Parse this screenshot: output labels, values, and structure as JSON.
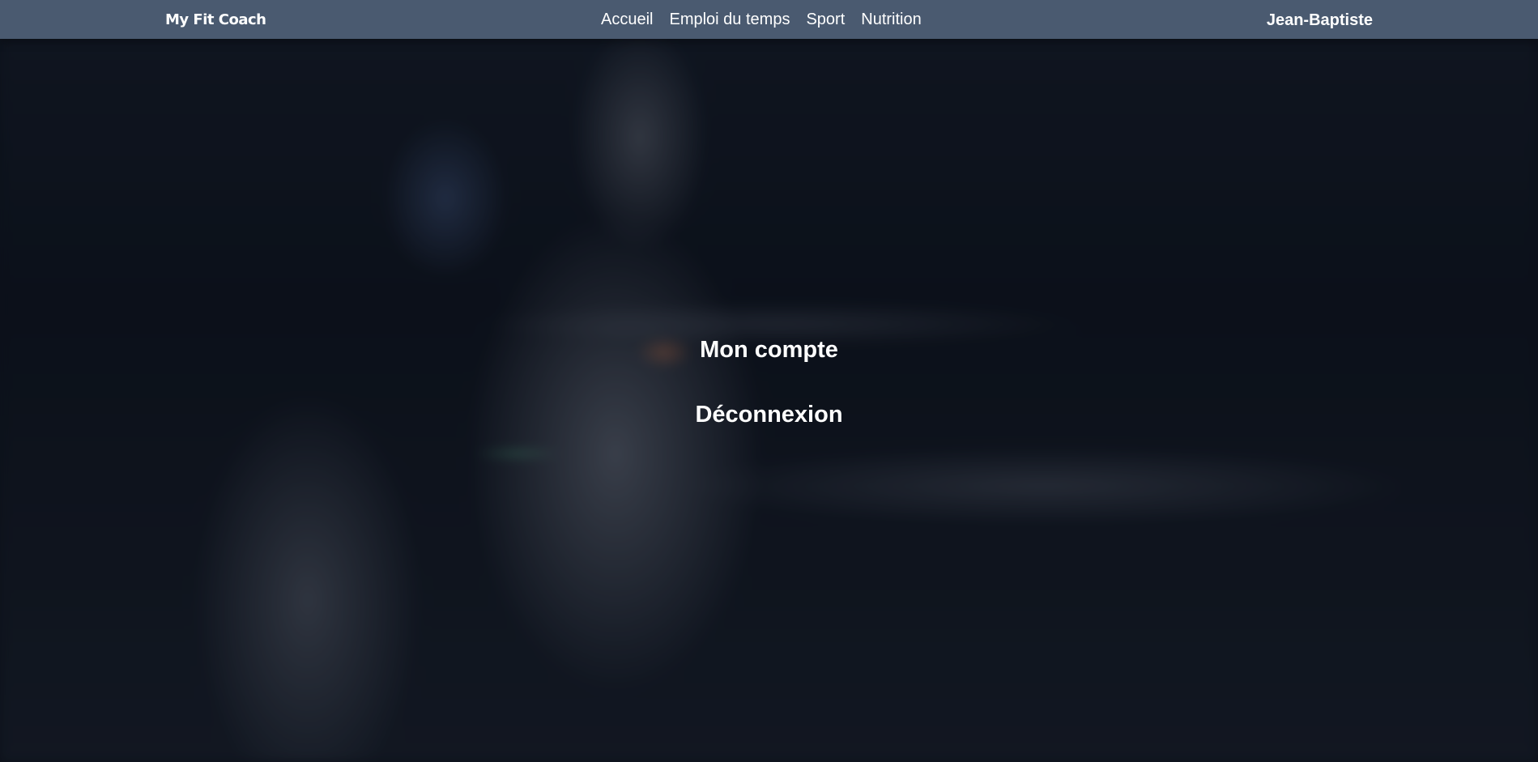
{
  "navbar": {
    "brand": "My Fit Coach",
    "links": [
      "Accueil",
      "Emploi du temps",
      "Sport",
      "Nutrition"
    ],
    "user": "Jean-Baptiste"
  },
  "account_menu": {
    "items": [
      "Mon compte",
      "Déconnexion"
    ]
  },
  "colors": {
    "navbar_background": "#4a5a70",
    "text": "#ffffff",
    "overlay": "#0d121b"
  }
}
